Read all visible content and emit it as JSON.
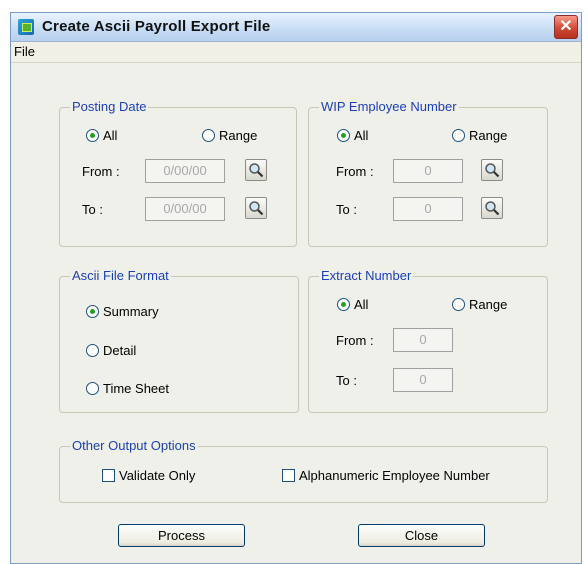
{
  "window": {
    "title": "Create Ascii Payroll Export File",
    "close_glyph": "✕"
  },
  "menu": {
    "file": "File"
  },
  "posting_date": {
    "legend": "Posting Date",
    "all": "All",
    "range": "Range",
    "from_label": "From :",
    "to_label": "To :",
    "from_value": "0/00/00",
    "to_value": "0/00/00",
    "selected": "All"
  },
  "wip_employee": {
    "legend": "WIP Employee Number",
    "all": "All",
    "range": "Range",
    "from_label": "From :",
    "to_label": "To :",
    "from_value": "0",
    "to_value": "0",
    "selected": "All"
  },
  "ascii_format": {
    "legend": "Ascii File Format",
    "options": [
      "Summary",
      "Detail",
      "Time Sheet"
    ],
    "selected": "Summary"
  },
  "extract_number": {
    "legend": "Extract Number",
    "all": "All",
    "range": "Range",
    "from_label": "From :",
    "to_label": "To :",
    "from_value": "0",
    "to_value": "0",
    "selected": "All"
  },
  "other_options": {
    "legend": "Other Output Options",
    "validate_only": "Validate Only",
    "alphanumeric": "Alphanumeric Employee Number"
  },
  "buttons": {
    "process": "Process",
    "close": "Close"
  }
}
